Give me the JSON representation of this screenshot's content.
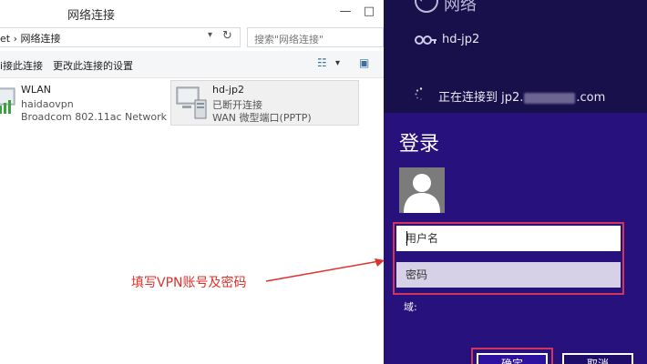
{
  "explorer": {
    "title": "网络连接",
    "address_text": "et › 网络连接",
    "search_placeholder": "搜索\"网络连接\"",
    "commands": {
      "connect": "i接此连接",
      "rename": "更改此连接的设置"
    },
    "connections": [
      {
        "name": "WLAN",
        "line1": "haidaovpn",
        "line2": "Broadcom 802.11ac Network ..."
      },
      {
        "name": "hd-jp2",
        "line1": "已断开连接",
        "line2": "WAN 微型端口(PPTP)"
      }
    ]
  },
  "annotation": {
    "text": "填写VPN账号及密码",
    "color": "#e0312b"
  },
  "network_pane": {
    "title": "网络",
    "vpn_name": "hd-jp2",
    "status_prefix": "正在连接到 jp2.",
    "status_suffix": ".com",
    "login": {
      "title": "登录",
      "username_placeholder": "用户名",
      "password_placeholder": "密码",
      "domain_label": "域:",
      "ok_label": "确定",
      "cancel_label": "取消"
    },
    "colors": {
      "pane_bg": "#1a0f4e",
      "login_bg": "#27117c",
      "highlight": "#d1355a"
    }
  }
}
